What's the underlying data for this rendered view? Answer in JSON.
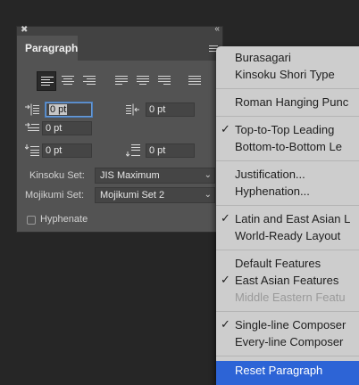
{
  "panel": {
    "tab_title": "Paragraph",
    "indent_left": "0 pt",
    "indent_right": "0 pt",
    "first_line": "0 pt",
    "space_before": "0 pt",
    "space_after": "0 pt",
    "kinsoku_label": "Kinsoku Set:",
    "kinsoku_value": "JIS Maximum",
    "mojikumi_label": "Mojikumi Set:",
    "mojikumi_value": "Mojikumi Set 2",
    "hyphenate_label": "Hyphenate",
    "hyphenate_checked": false,
    "align_selected": "align-left"
  },
  "menu": {
    "burasagari": "Burasagari",
    "kinsoku_shori": "Kinsoku Shori Type",
    "roman_hanging": "Roman Hanging Punc",
    "top_to_top": "Top-to-Top Leading",
    "bottom_to_bottom": "Bottom-to-Bottom Le",
    "justification": "Justification...",
    "hyphenation": "Hyphenation...",
    "latin_east_asian": "Latin and East Asian L",
    "world_ready": "World-Ready Layout",
    "default_features": "Default Features",
    "east_asian": "East Asian Features",
    "middle_eastern": "Middle Eastern Featu",
    "single_line": "Single-line Composer",
    "every_line": "Every-line Composer",
    "reset": "Reset Paragraph",
    "checkmark": "✓",
    "highlight_color": "#2d64d6"
  }
}
